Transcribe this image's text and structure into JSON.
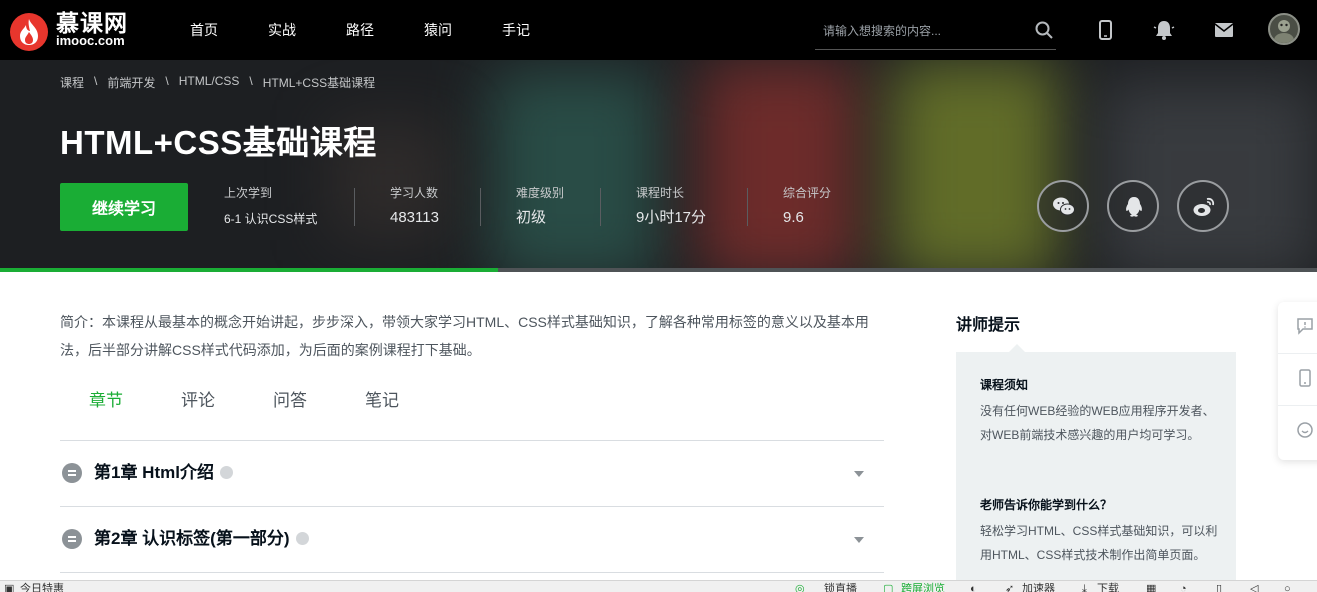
{
  "logo": {
    "cn": "慕课网",
    "en": "imooc.com"
  },
  "nav": [
    "首页",
    "实战",
    "路径",
    "猿问",
    "手记"
  ],
  "search": {
    "placeholder": "请输入想搜索的内容..."
  },
  "header_icons": [
    "search-icon",
    "phone-icon",
    "bell-icon",
    "mail-icon"
  ],
  "breadcrumb": [
    "课程",
    "前端开发",
    "HTML/CSS",
    "HTML+CSS基础课程"
  ],
  "course": {
    "title": "HTML+CSS基础课程",
    "continue_label": "继续学习",
    "last_study_label": "上次学到",
    "last_study_value": "6-1 认识CSS样式",
    "learners_label": "学习人数",
    "learners_value": "483113",
    "difficulty_label": "难度级别",
    "difficulty_value": "初级",
    "duration_label": "课程时长",
    "duration_value": "9小时17分",
    "rating_label": "综合评分",
    "rating_value": "9.6",
    "progress": 0.378
  },
  "share_icons": [
    "wechat-icon",
    "qq-icon",
    "weibo-icon"
  ],
  "intro": "简介：本课程从最基本的概念开始讲起，步步深入，带领大家学习HTML、CSS样式基础知识，了解各种常用标签的意义以及基本用法，后半部分讲解CSS样式代码添加，为后面的案例课程打下基础。",
  "tabs": [
    {
      "label": "章节",
      "active": true
    },
    {
      "label": "评论",
      "active": false
    },
    {
      "label": "问答",
      "active": false
    },
    {
      "label": "笔记",
      "active": false
    }
  ],
  "chapters": [
    "第1章 Html介绍",
    "第2章 认识标签(第一部分)"
  ],
  "aside": {
    "title": "讲师提示",
    "notice_heading": "课程须知",
    "notice_text": "没有任何WEB经验的WEB应用程序开发者、对WEB前端技术感兴趣的用户均可学习。",
    "learn_heading": "老师告诉你能学到什么？",
    "learn_text": "轻松学习HTML、CSS样式基础知识，可以利用HTML、CSS样式技术制作出简单页面。"
  },
  "floating_tools": [
    "feedback-icon",
    "mobile-icon",
    "chat-icon"
  ],
  "statusbar": {
    "left": "今日特惠",
    "items": [
      "锁直播",
      "跨屏浏览",
      "加速器",
      "下载"
    ]
  },
  "colors": {
    "accent": "#1aad35",
    "topbar": "#000000",
    "banner": "#1d1f22",
    "brand_red": "#e8362d"
  }
}
